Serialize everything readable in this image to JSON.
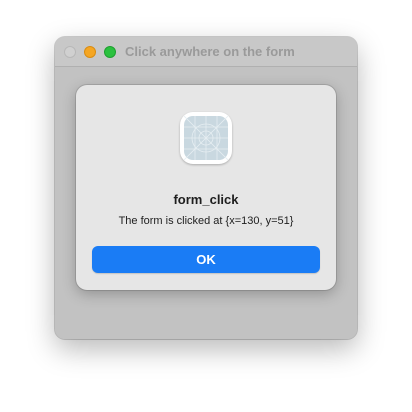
{
  "window": {
    "title": "Click anywhere on the form"
  },
  "alert": {
    "icon": "generic-app-icon",
    "title": "form_click",
    "message": "The form is clicked at {x=130, y=51}",
    "ok_label": "OK"
  },
  "colors": {
    "accent": "#1a7cf5",
    "window_bg": "#c2c2c2",
    "alert_bg": "#e6e6e6",
    "traffic_minimize": "#f5a623",
    "traffic_maximize": "#2bc13f",
    "traffic_close_inactive": "#d0d0d0"
  }
}
